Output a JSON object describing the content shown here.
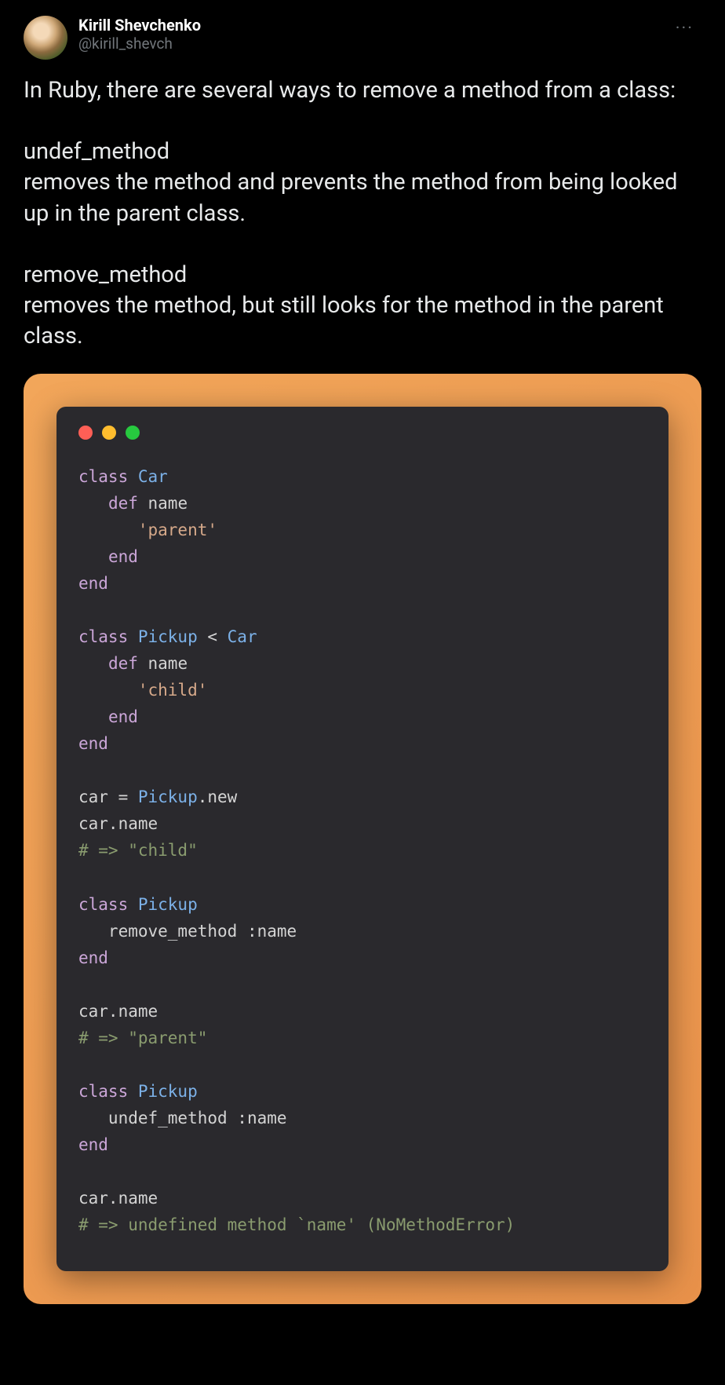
{
  "author": {
    "display_name": "Kirill Shevchenko",
    "handle": "@kirill_shevch"
  },
  "more_glyph": "···",
  "tweet_text": "In Ruby, there are several ways to remove a method from a class:\n\nundef_method\nremoves the method and prevents the method from being looked up in the parent class.\n\nremove_method\nremoves the method, but still looks for the method in the parent class.",
  "code": {
    "lines": [
      [
        {
          "t": "class ",
          "c": "tok-keyword"
        },
        {
          "t": "Car",
          "c": "tok-class"
        }
      ],
      [
        {
          "t": "   ",
          "c": ""
        },
        {
          "t": "def ",
          "c": "tok-def"
        },
        {
          "t": "name",
          "c": "tok-method"
        }
      ],
      [
        {
          "t": "      ",
          "c": ""
        },
        {
          "t": "'parent'",
          "c": "tok-string"
        }
      ],
      [
        {
          "t": "   ",
          "c": ""
        },
        {
          "t": "end",
          "c": "tok-keyword"
        }
      ],
      [
        {
          "t": "end",
          "c": "tok-keyword"
        }
      ],
      [],
      [
        {
          "t": "class ",
          "c": "tok-keyword"
        },
        {
          "t": "Pickup",
          "c": "tok-class"
        },
        {
          "t": " < ",
          "c": "tok-op"
        },
        {
          "t": "Car",
          "c": "tok-class"
        }
      ],
      [
        {
          "t": "   ",
          "c": ""
        },
        {
          "t": "def ",
          "c": "tok-def"
        },
        {
          "t": "name",
          "c": "tok-method"
        }
      ],
      [
        {
          "t": "      ",
          "c": ""
        },
        {
          "t": "'child'",
          "c": "tok-string"
        }
      ],
      [
        {
          "t": "   ",
          "c": ""
        },
        {
          "t": "end",
          "c": "tok-keyword"
        }
      ],
      [
        {
          "t": "end",
          "c": "tok-keyword"
        }
      ],
      [],
      [
        {
          "t": "car = ",
          "c": "tok-var"
        },
        {
          "t": "Pickup",
          "c": "tok-class"
        },
        {
          "t": ".new",
          "c": "tok-method"
        }
      ],
      [
        {
          "t": "car.name",
          "c": "tok-var"
        }
      ],
      [
        {
          "t": "# => \"child\"",
          "c": "tok-comment"
        }
      ],
      [],
      [
        {
          "t": "class ",
          "c": "tok-keyword"
        },
        {
          "t": "Pickup",
          "c": "tok-class"
        }
      ],
      [
        {
          "t": "   remove_method ",
          "c": "tok-method"
        },
        {
          "t": ":name",
          "c": "tok-symbol"
        }
      ],
      [
        {
          "t": "end",
          "c": "tok-keyword"
        }
      ],
      [],
      [
        {
          "t": "car.name",
          "c": "tok-var"
        }
      ],
      [
        {
          "t": "# => \"parent\"",
          "c": "tok-comment"
        }
      ],
      [],
      [
        {
          "t": "class ",
          "c": "tok-keyword"
        },
        {
          "t": "Pickup",
          "c": "tok-class"
        }
      ],
      [
        {
          "t": "   undef_method ",
          "c": "tok-method"
        },
        {
          "t": ":name",
          "c": "tok-symbol"
        }
      ],
      [
        {
          "t": "end",
          "c": "tok-keyword"
        }
      ],
      [],
      [
        {
          "t": "car.name",
          "c": "tok-var"
        }
      ],
      [
        {
          "t": "# => undefined method `name' (NoMethodError)",
          "c": "tok-comment"
        }
      ]
    ]
  }
}
